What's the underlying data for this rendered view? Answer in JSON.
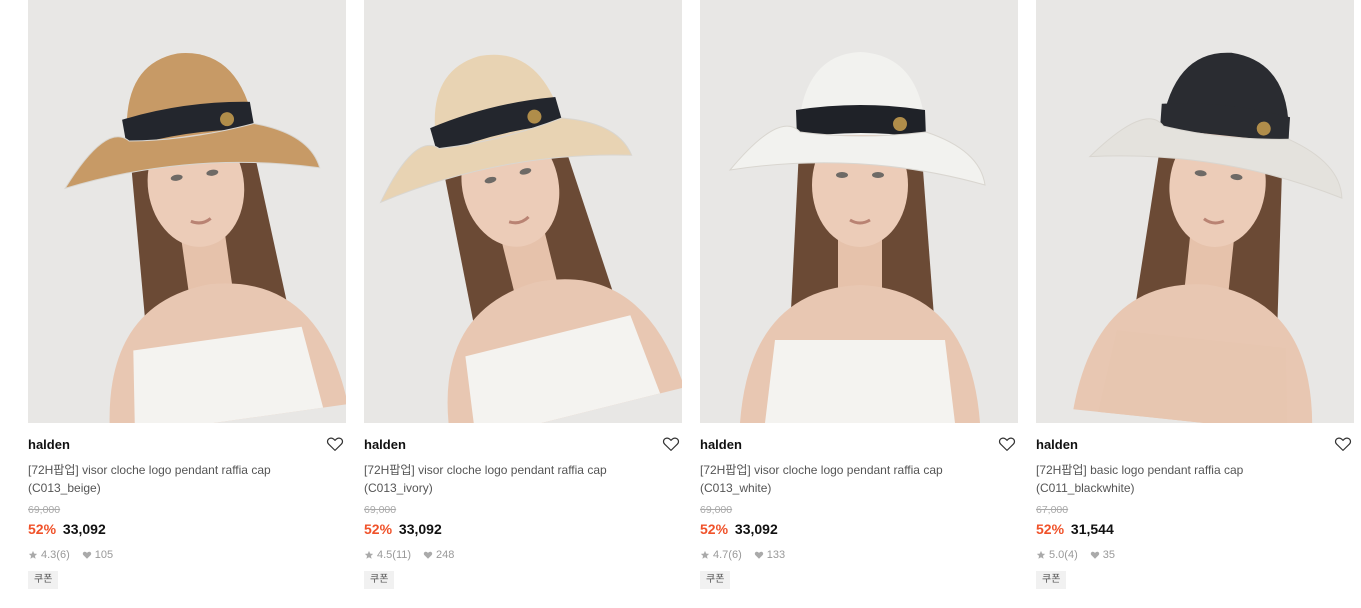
{
  "products": [
    {
      "brand": "halden",
      "title_line1": "[72H팝업] visor cloche logo pendant raffia cap",
      "title_line2": "(C013_beige)",
      "original_price": "69,000",
      "discount": "52%",
      "price": "33,092",
      "rating": "4.3",
      "reviews": "(6)",
      "likes": "105",
      "badge": "쿠폰",
      "hat_color": "#c79a66",
      "band_color": "#23262d",
      "brim_color": "#c79a66"
    },
    {
      "brand": "halden",
      "title_line1": "[72H팝업] visor cloche logo pendant raffia cap",
      "title_line2": "(C013_ivory)",
      "original_price": "69,000",
      "discount": "52%",
      "price": "33,092",
      "rating": "4.5",
      "reviews": "(11)",
      "likes": "248",
      "badge": "쿠폰",
      "hat_color": "#e8d3b3",
      "band_color": "#23262d",
      "brim_color": "#e8d3b3"
    },
    {
      "brand": "halden",
      "title_line1": "[72H팝업] visor cloche logo pendant raffia cap",
      "title_line2": "(C013_white)",
      "original_price": "69,000",
      "discount": "52%",
      "price": "33,092",
      "rating": "4.7",
      "reviews": "(6)",
      "likes": "133",
      "badge": "쿠폰",
      "hat_color": "#f2f2ef",
      "band_color": "#1f2228",
      "brim_color": "#f2f2ef"
    },
    {
      "brand": "halden",
      "title_line1": "[72H팝업] basic logo pendant raffia cap",
      "title_line2": "(C011_blackwhite)",
      "original_price": "67,000",
      "discount": "52%",
      "price": "31,544",
      "rating": "5.0",
      "reviews": "(4)",
      "likes": "35",
      "badge": "쿠폰",
      "hat_color": "#2a2c31",
      "band_color": "#2a2c31",
      "brim_color": "#e4e2dd"
    }
  ],
  "colors": {
    "discount": "#f0522a",
    "text_primary": "#111111",
    "text_muted": "#999999"
  },
  "icons": [
    "heart-outline-icon",
    "star-icon",
    "heart-filled-icon"
  ]
}
